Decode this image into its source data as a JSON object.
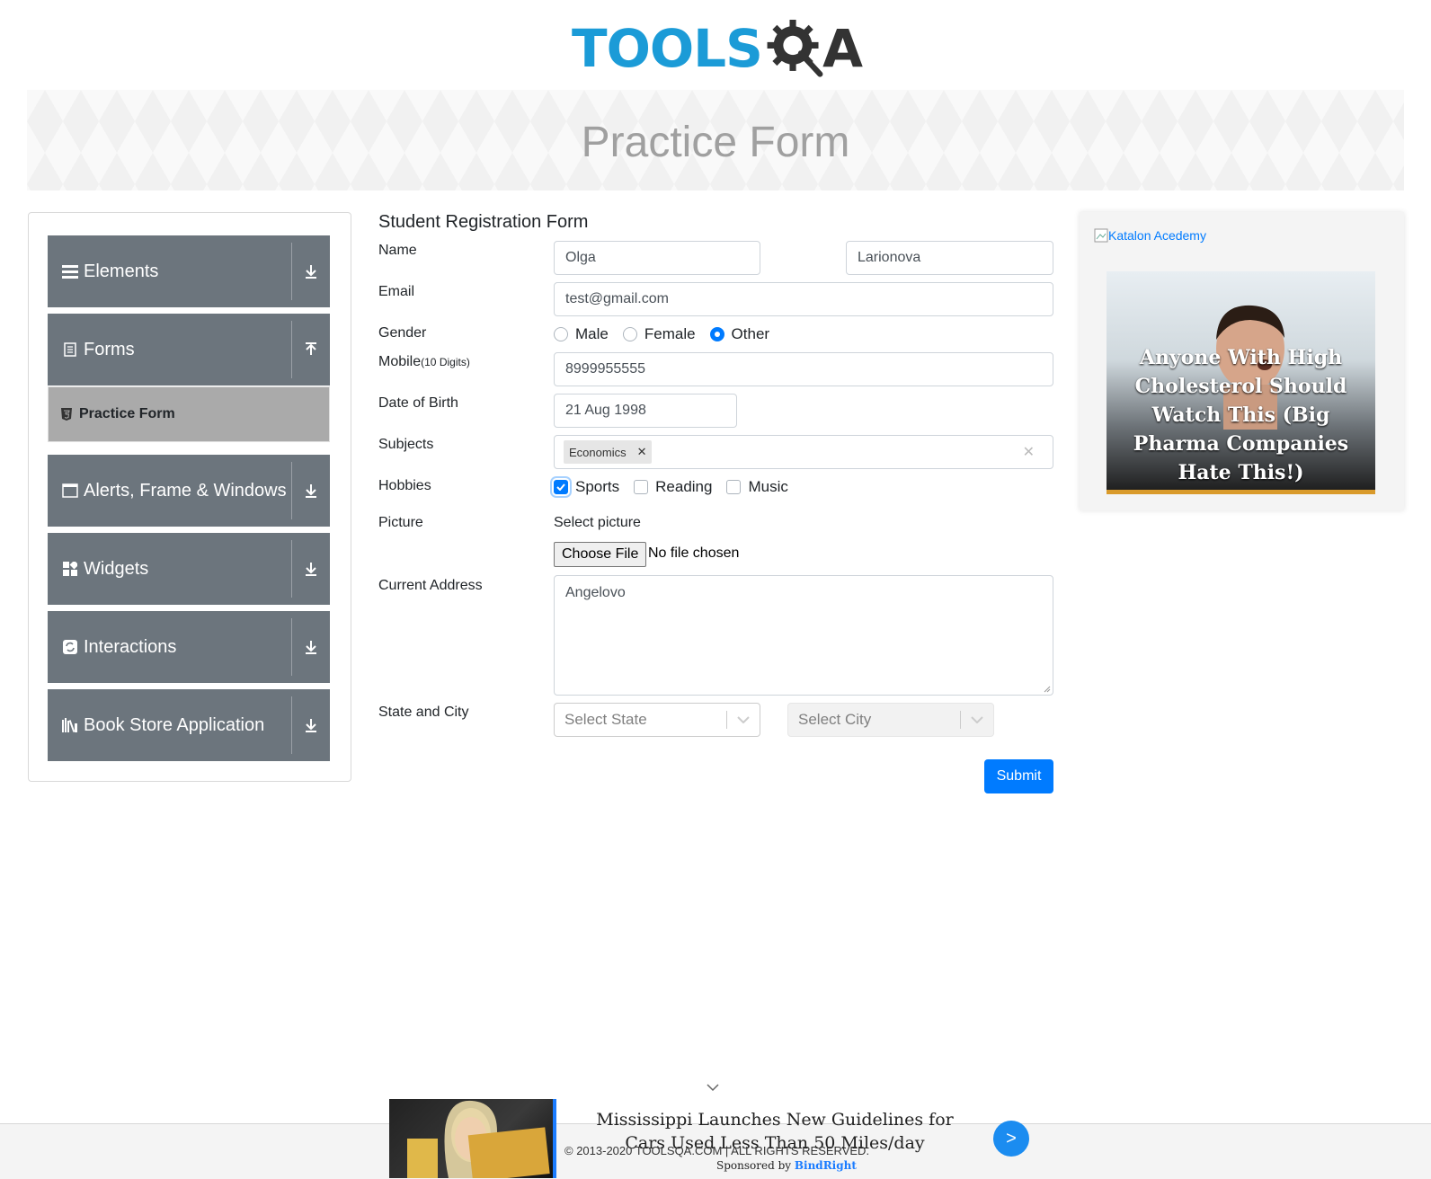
{
  "logo": {
    "text": "TOOLS",
    "suffix": "A"
  },
  "banner": {
    "title": "Practice Form"
  },
  "sidebar": {
    "groups": [
      {
        "label": "Elements",
        "icon": "menu-icon",
        "arrow": "download-arrow-icon"
      },
      {
        "label": "Forms",
        "icon": "document-icon",
        "arrow": "upload-arrow-icon"
      },
      {
        "label": "Alerts, Frame & Windows",
        "icon": "window-icon",
        "arrow": "download-arrow-icon"
      },
      {
        "label": "Widgets",
        "icon": "widgets-icon",
        "arrow": "download-arrow-icon"
      },
      {
        "label": "Interactions",
        "icon": "interactions-icon",
        "arrow": "download-arrow-icon"
      },
      {
        "label": "Book Store Application",
        "icon": "books-icon",
        "arrow": "download-arrow-icon"
      }
    ],
    "active_item": {
      "label": "Practice Form",
      "icon": "html5-icon"
    }
  },
  "form": {
    "title": "Student Registration Form",
    "labels": {
      "name": "Name",
      "email": "Email",
      "gender": "Gender",
      "mobile": "Mobile",
      "mobile_hint": "(10 Digits)",
      "dob": "Date of Birth",
      "subjects": "Subjects",
      "hobbies": "Hobbies",
      "picture": "Picture",
      "address": "Current Address",
      "state_city": "State and City"
    },
    "first_name": "Olga",
    "last_name": "Larionova",
    "email": "test@gmail.com",
    "gender_options": [
      {
        "label": "Male",
        "checked": false
      },
      {
        "label": "Female",
        "checked": false
      },
      {
        "label": "Other",
        "checked": true
      }
    ],
    "mobile": "8999955555",
    "dob": "21 Aug 1998",
    "subjects": [
      "Economics"
    ],
    "hobbies": [
      {
        "label": "Sports",
        "checked": true
      },
      {
        "label": "Reading",
        "checked": false
      },
      {
        "label": "Music",
        "checked": false
      }
    ],
    "picture_label": "Select picture",
    "file_button": "Choose File",
    "file_status": "No file chosen",
    "address": "Angelovo",
    "state_placeholder": "Select State",
    "city_placeholder": "Select City",
    "submit": "Submit"
  },
  "ad": {
    "alt_link": "Katalon Acedemy",
    "caption": "Anyone With High Cholesterol Should Watch This (Big Pharma Companies Hate This!)"
  },
  "footer": {
    "copyright": "© 2013-2020 TOOLSQA.COM | ALL RIGHTS RESERVED."
  },
  "bottom_ad": {
    "title": "Mississippi Launches New Guidelines for Cars Used Less Than 50 Miles/day",
    "next": ">",
    "sponsored_prefix": "Sponsored by",
    "sponsor": "BindRight"
  },
  "colors": {
    "primary": "#007bff",
    "sidebar": "#6c757d",
    "active": "#aaaaaa",
    "logo_blue": "#1b9bd7"
  }
}
